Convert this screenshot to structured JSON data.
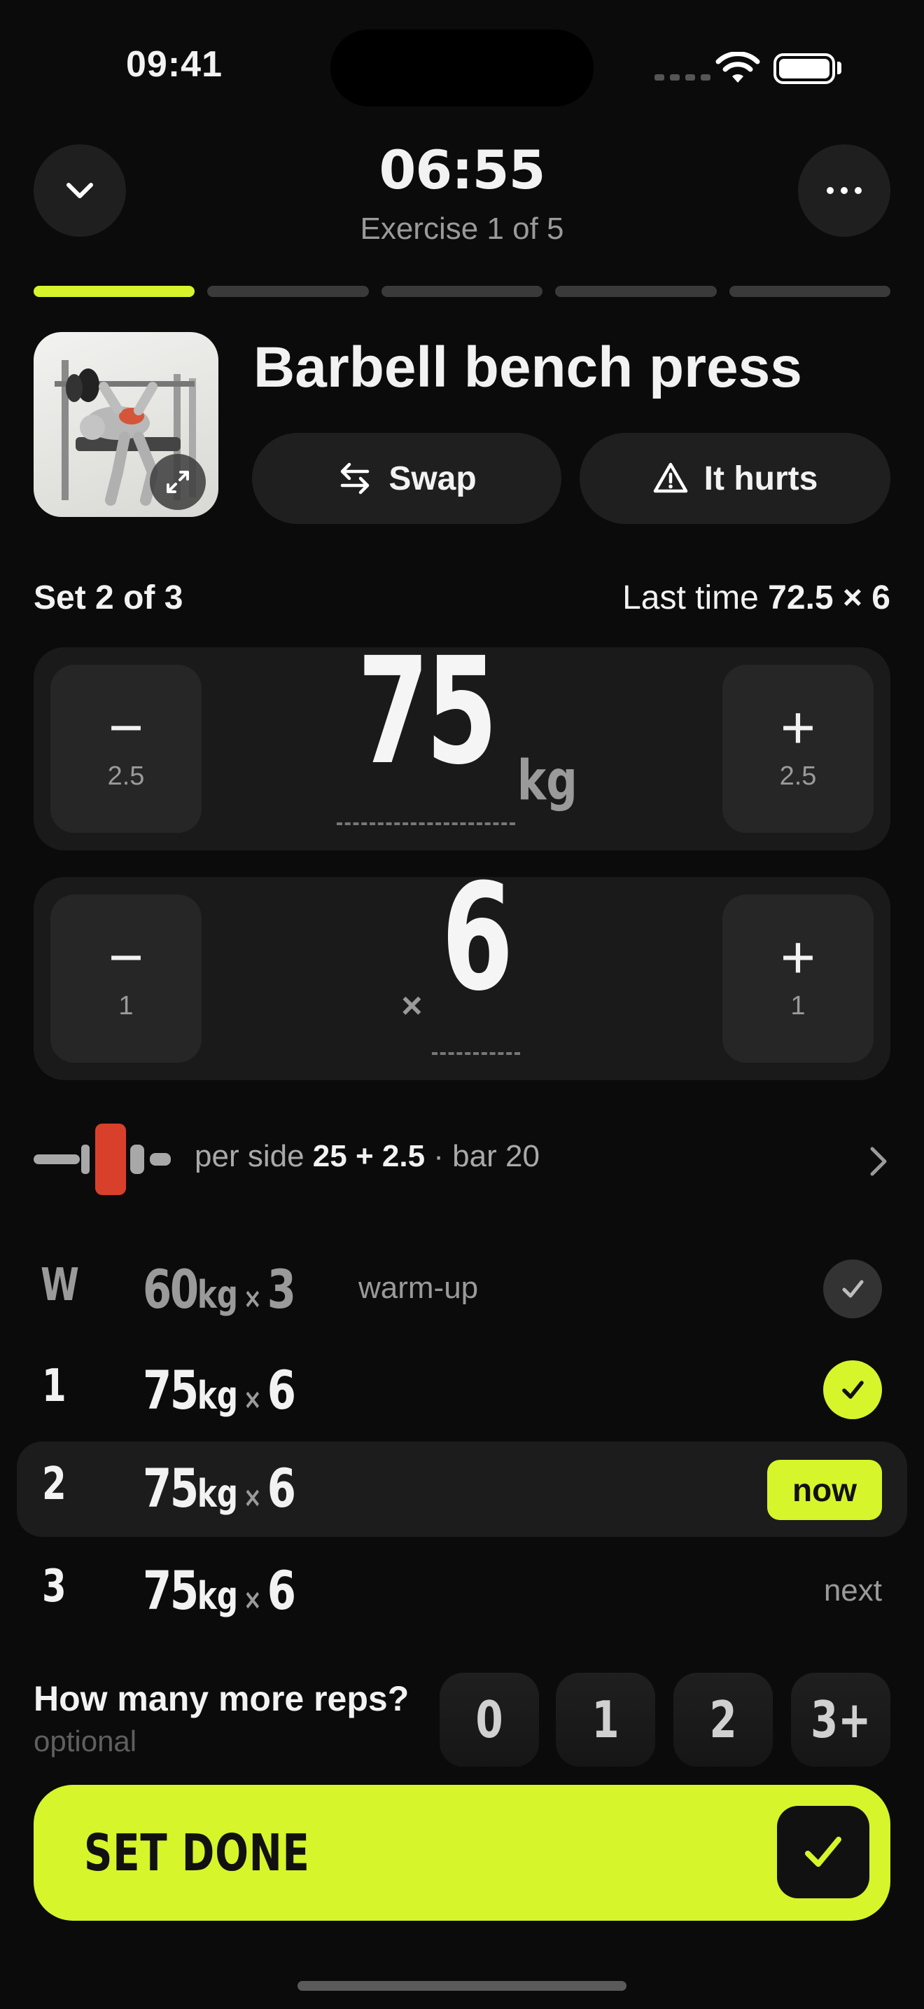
{
  "status_bar": {
    "time": "09:41"
  },
  "header": {
    "timer": "06:55",
    "exercise_progress": "Exercise 1 of 5",
    "progress_segments": 5,
    "active_segment": 1
  },
  "exercise": {
    "name": "Barbell bench press",
    "swap_label": "Swap",
    "hurts_label": "It hurts"
  },
  "set_info": {
    "set_label": "Set 2 of 3",
    "last_time_prefix": "Last time",
    "last_time_value": "72.5 × 6"
  },
  "weight": {
    "value": "75",
    "unit": "kg",
    "minus_step": "2.5",
    "plus_step": "2.5"
  },
  "reps": {
    "prefix": "×",
    "value": "6",
    "minus_step": "1",
    "plus_step": "1"
  },
  "plates": {
    "prefix": "per side",
    "per_side": "25 + 2.5",
    "bar": "· bar 20"
  },
  "sets": [
    {
      "label": "W",
      "weight": "60",
      "unit": "kg",
      "times": "×",
      "reps": "3",
      "note": "warm-up",
      "status": "done-warmup"
    },
    {
      "label": "1",
      "weight": "75",
      "unit": "kg",
      "times": "×",
      "reps": "6",
      "note": "",
      "status": "done"
    },
    {
      "label": "2",
      "weight": "75",
      "unit": "kg",
      "times": "×",
      "reps": "6",
      "note": "",
      "status": "now"
    },
    {
      "label": "3",
      "weight": "75",
      "unit": "kg",
      "times": "×",
      "reps": "6",
      "note": "",
      "status": "next"
    }
  ],
  "status_labels": {
    "now": "now",
    "next": "next"
  },
  "rir": {
    "question": "How many more reps?",
    "optional": "optional",
    "options": [
      "0",
      "1",
      "2",
      "3+"
    ]
  },
  "done_button": {
    "label": "SET DONE"
  },
  "colors": {
    "accent": "#d6f52b",
    "background": "#0b0b0b",
    "plate_accent": "#d9402b"
  },
  "icons": [
    "chevron-down-icon",
    "more-icon",
    "swap-icon",
    "warning-icon",
    "expand-icon",
    "minus-icon",
    "plus-icon",
    "barbell-icon",
    "chevron-right-icon",
    "check-icon"
  ]
}
